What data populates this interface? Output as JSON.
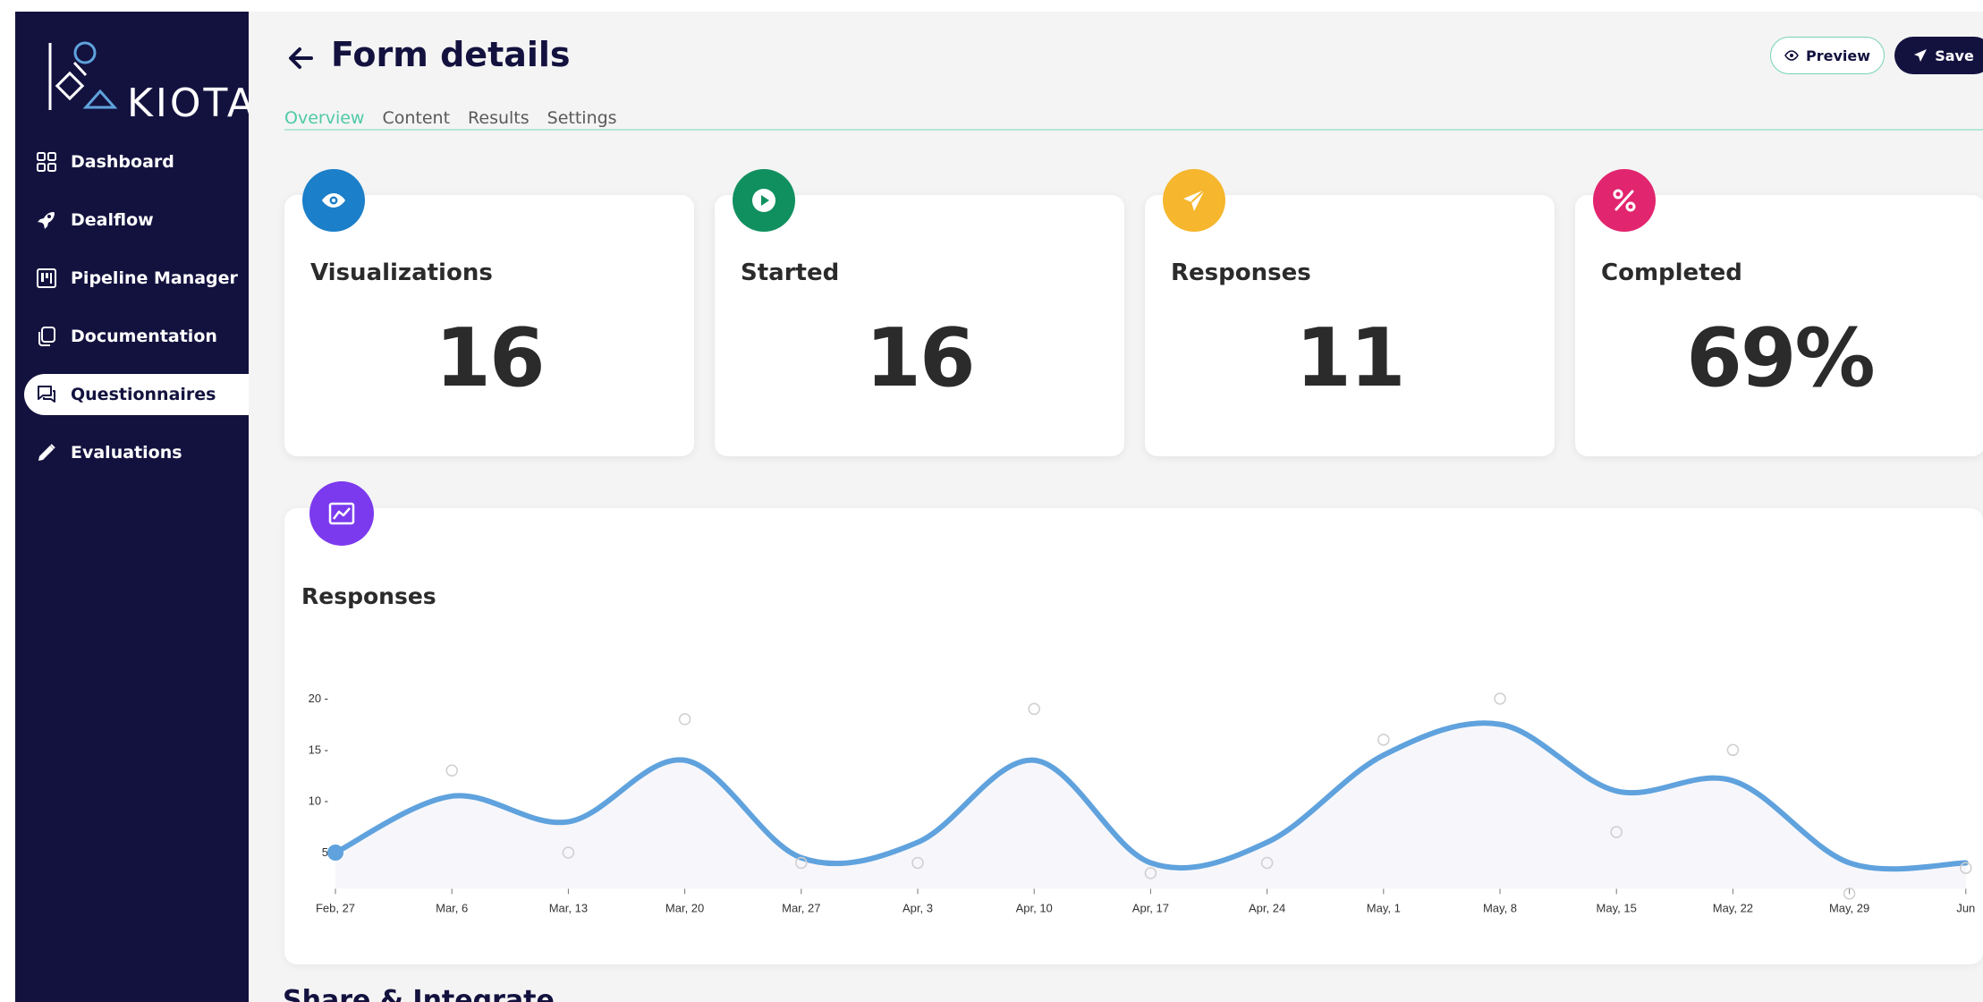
{
  "app": {
    "name": "KIOTA"
  },
  "sidebar": {
    "items": [
      {
        "label": "Dashboard",
        "icon": "grid-icon"
      },
      {
        "label": "Dealflow",
        "icon": "rocket-icon"
      },
      {
        "label": "Pipeline Manager",
        "icon": "kanban-icon"
      },
      {
        "label": "Documentation",
        "icon": "copy-icon"
      },
      {
        "label": "Questionnaires",
        "icon": "chat-icon",
        "active": true
      },
      {
        "label": "Evaluations",
        "icon": "pencil-icon"
      }
    ]
  },
  "header": {
    "title": "Form details",
    "preview_label": "Preview",
    "save_label": "Save"
  },
  "tabs": [
    {
      "label": "Overview",
      "active": true
    },
    {
      "label": "Content"
    },
    {
      "label": "Results"
    },
    {
      "label": "Settings"
    }
  ],
  "stats": [
    {
      "title": "Visualizations",
      "value": "16",
      "icon": "eye-icon",
      "color": "#1b7fc9"
    },
    {
      "title": "Started",
      "value": "16",
      "icon": "play-icon",
      "color": "#11905f"
    },
    {
      "title": "Responses",
      "value": "11",
      "icon": "send-icon",
      "color": "#f6b62d"
    },
    {
      "title": "Completed",
      "value": "69%",
      "icon": "percent-icon",
      "color": "#e2256f"
    }
  ],
  "chart": {
    "icon": "chart-line-icon",
    "icon_color": "#7b3aee",
    "line_color": "#5fa2dd"
  },
  "chart_data": {
    "type": "line",
    "title": "Responses",
    "x": [
      "Feb, 27",
      "Mar, 6",
      "Mar, 13",
      "Mar, 20",
      "Mar, 27",
      "Apr, 3",
      "Apr, 10",
      "Apr, 17",
      "Apr, 24",
      "May, 1",
      "May, 8",
      "May, 15",
      "May, 22",
      "May, 29",
      "Jun"
    ],
    "yticks": [
      5,
      10,
      15,
      20
    ],
    "ylim": [
      2,
      22
    ],
    "grid": false,
    "points": [
      5,
      13,
      5,
      18,
      4,
      4,
      19,
      3,
      4,
      16,
      20,
      7,
      15,
      1,
      3.5
    ],
    "smooth_line": [
      5,
      10.5,
      8,
      14,
      4.5,
      6,
      14,
      4,
      6,
      14.5,
      17.5,
      11,
      12,
      4,
      4
    ]
  },
  "share": {
    "title": "Share & Integrate"
  }
}
